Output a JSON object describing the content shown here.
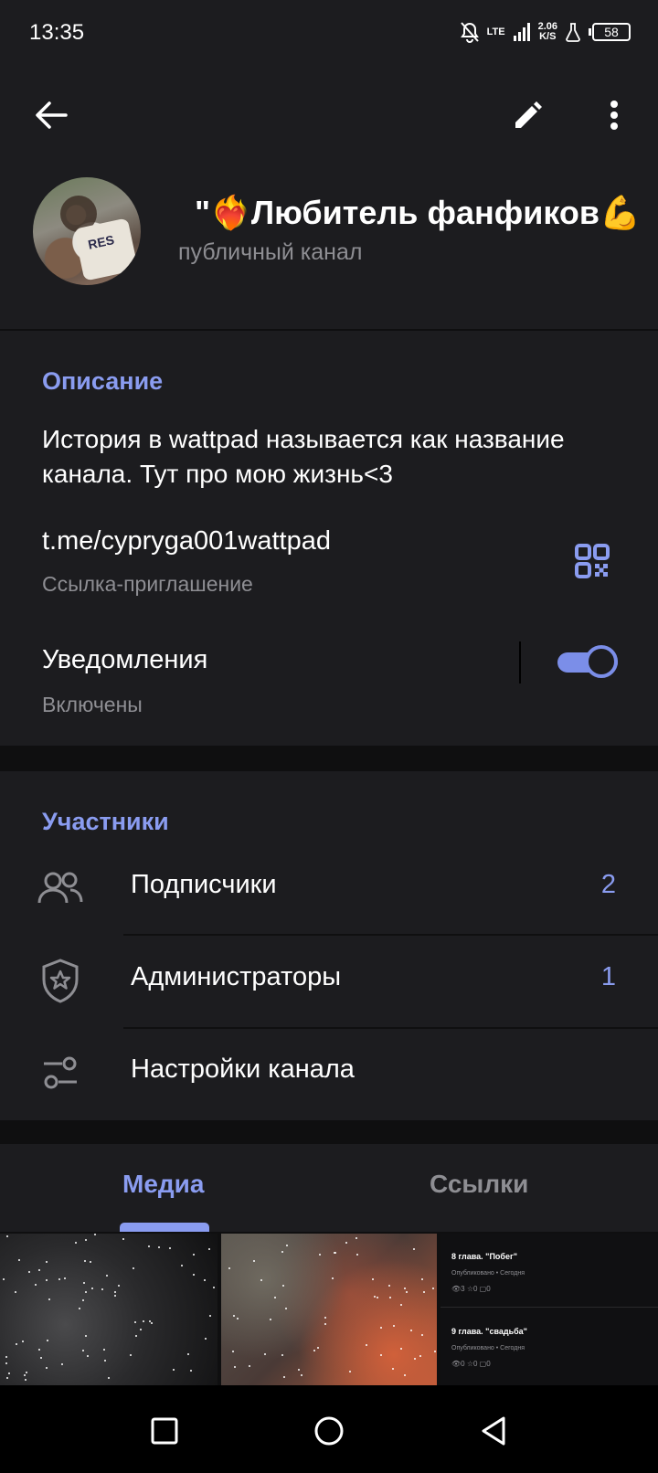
{
  "status_bar": {
    "time": "13:35",
    "network": "LTE",
    "speed_value": "2.06",
    "speed_unit": "K/S",
    "battery": "58"
  },
  "top_bar": {
    "back_icon": "arrow-left-icon",
    "edit_icon": "pencil-icon",
    "more_icon": "more-vertical-icon"
  },
  "profile": {
    "title": "\"❤️‍🔥Любитель фанфиков💪",
    "subtitle": "публичный канал",
    "avatar_jersey_text": "RES"
  },
  "info": {
    "description_header": "Описание",
    "description_text": "История в wattpad называется как название канала. Тут про мою жизнь<3",
    "link": "t.me/cypryga001wattpad",
    "link_caption": "Ссылка-приглашение",
    "notifications_label": "Уведомления",
    "notifications_status": "Включены",
    "notifications_on": true
  },
  "members": {
    "header": "Участники",
    "items": [
      {
        "label": "Подписчики",
        "count": "2",
        "icon": "users-icon"
      },
      {
        "label": "Администраторы",
        "count": "1",
        "icon": "admin-shield-icon"
      },
      {
        "label": "Настройки канала",
        "count": "",
        "icon": "settings-sliders-icon"
      }
    ]
  },
  "tabs": {
    "items": [
      {
        "label": "Медиа",
        "active": true
      },
      {
        "label": "Ссылки",
        "active": false
      }
    ]
  },
  "media": {
    "post_1_title": "8 глава. \"Побег\"",
    "post_1_meta": "Опубликовано • Сегодня",
    "post_1_stats": "👁3  ☆0  ▢0",
    "post_2_title": "9 глава. \"свадьба\"",
    "post_2_meta": "Опубликовано • Сегодня",
    "post_2_stats": "👁0  ☆0  ▢0"
  },
  "colors": {
    "accent": "#8a9cf0",
    "background": "#1c1c1f",
    "separator": "#0f0f10",
    "secondary_text": "#8e8e93"
  }
}
